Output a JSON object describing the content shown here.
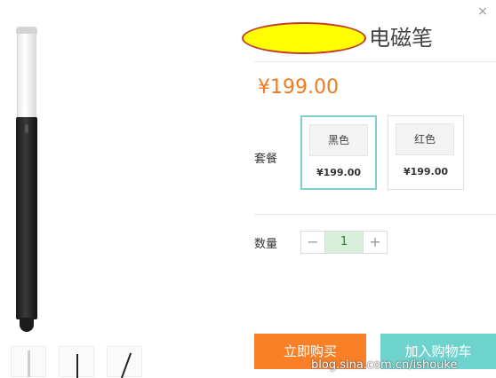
{
  "dialog": {
    "close_icon": "×"
  },
  "product": {
    "title_suffix": "电磁笔",
    "price": "¥199.00"
  },
  "package": {
    "label": "套餐",
    "options": [
      {
        "name": "黑色",
        "price": "¥199.00",
        "selected": true
      },
      {
        "name": "红色",
        "price": "¥199.00",
        "selected": false
      }
    ]
  },
  "quantity": {
    "label": "数量",
    "minus": "−",
    "value": "1",
    "plus": "+"
  },
  "actions": {
    "buy_now": "立即购买",
    "add_to_cart": "加入购物车"
  },
  "watermark": "blog.sina.com.cn/ishouke",
  "colors": {
    "accent_orange": "#f98026",
    "accent_teal": "#6fd3cd",
    "price_orange": "#f07a1e"
  }
}
